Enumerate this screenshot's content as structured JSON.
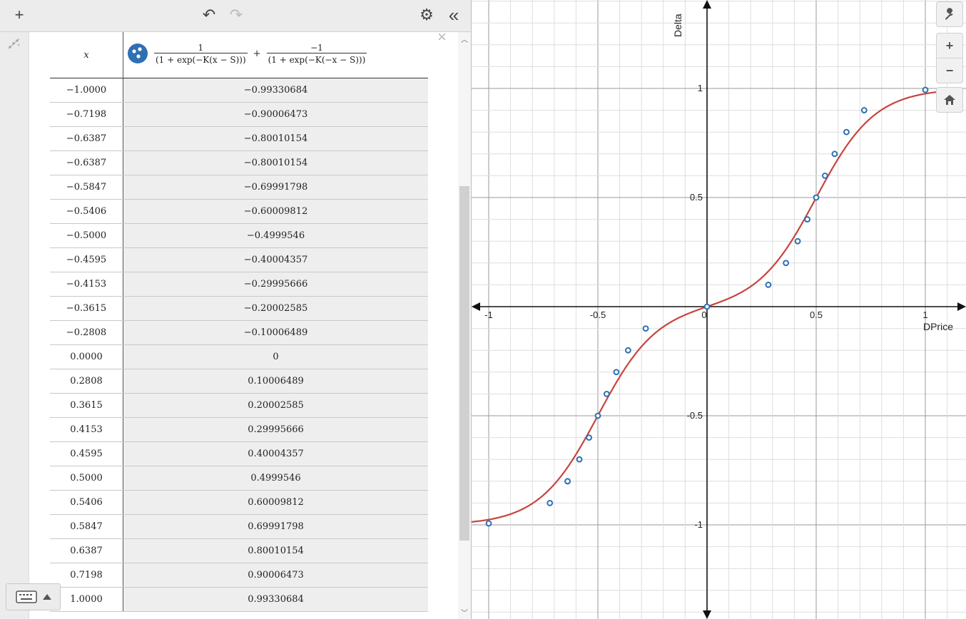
{
  "toolbar": {
    "add_icon": "+",
    "undo_icon": "↶",
    "redo_icon": "↷",
    "settings_icon": "⚙",
    "collapse_icon": "«"
  },
  "table": {
    "x_header": "x",
    "expr": {
      "num1": "1",
      "den1": "(1 + exp(−K(x − S)))",
      "plus": "+",
      "num2": "−1",
      "den2": "(1 + exp(−K(−x − S)))"
    },
    "close_icon": "×",
    "rows": [
      [
        "−1.0000",
        "−0.99330684"
      ],
      [
        "−0.7198",
        "−0.90006473"
      ],
      [
        "−0.6387",
        "−0.80010154"
      ],
      [
        "−0.6387",
        "−0.80010154"
      ],
      [
        "−0.5847",
        "−0.69991798"
      ],
      [
        "−0.5406",
        "−0.60009812"
      ],
      [
        "−0.5000",
        "−0.4999546"
      ],
      [
        "−0.4595",
        "−0.40004357"
      ],
      [
        "−0.4153",
        "−0.29995666"
      ],
      [
        "−0.3615",
        "−0.20002585"
      ],
      [
        "−0.2808",
        "−0.10006489"
      ],
      [
        "0.0000",
        "0"
      ],
      [
        "0.2808",
        "0.10006489"
      ],
      [
        "0.3615",
        "0.20002585"
      ],
      [
        "0.4153",
        "0.29995666"
      ],
      [
        "0.4595",
        "0.40004357"
      ],
      [
        "0.5000",
        "0.4999546"
      ],
      [
        "0.5406",
        "0.60009812"
      ],
      [
        "0.5847",
        "0.69991798"
      ],
      [
        "0.6387",
        "0.80010154"
      ],
      [
        "0.7198",
        "0.90006473"
      ],
      [
        "1.0000",
        "0.99330684"
      ]
    ]
  },
  "graph": {
    "x_axis_label": "DPrice",
    "y_axis_label": "Delta",
    "x_ticks": [
      [
        "-1",
        -1
      ],
      [
        "-0.5",
        -0.5
      ],
      [
        "0",
        0
      ],
      [
        "0.5",
        0.5
      ],
      [
        "1",
        1
      ]
    ],
    "y_ticks": [
      [
        "1",
        1
      ],
      [
        "0.5",
        0.5
      ],
      [
        "-0.5",
        -0.5
      ],
      [
        "-1",
        -1
      ]
    ],
    "curve_color": "#c74440",
    "point_color": "#2d70b3",
    "wrench_icon": "🔧",
    "zoom_in": "+",
    "zoom_out": "−",
    "home_icon": "⌂"
  },
  "chart_data": {
    "type": "line",
    "title": "",
    "xlabel": "DPrice",
    "ylabel": "Delta",
    "xlim": [
      -1.06,
      1.17
    ],
    "ylim": [
      -1.42,
      1.4
    ],
    "grid": true,
    "series": [
      {
        "name": "",
        "x": [
          -1.0,
          -0.7198,
          -0.6387,
          -0.6387,
          -0.5847,
          -0.5406,
          -0.5,
          -0.4595,
          -0.4153,
          -0.3615,
          -0.2808,
          0.0,
          0.2808,
          0.3615,
          0.4153,
          0.4595,
          0.5,
          0.5406,
          0.5847,
          0.6387,
          0.7198,
          1.0
        ],
        "y": [
          -0.99330684,
          -0.90006473,
          -0.80010154,
          -0.80010154,
          -0.69991798,
          -0.60009812,
          -0.4999546,
          -0.40004357,
          -0.29995666,
          -0.20002585,
          -0.10006489,
          0,
          0.10006489,
          0.20002585,
          0.29995666,
          0.40004357,
          0.4999546,
          0.60009812,
          0.69991798,
          0.80010154,
          0.90006473,
          0.99330684
        ]
      }
    ]
  }
}
